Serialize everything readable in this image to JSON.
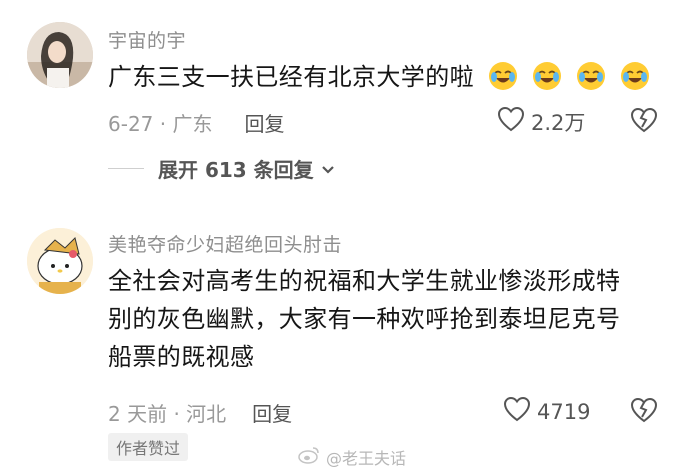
{
  "comments": [
    {
      "username": "宇宙的宇",
      "text": "广东三支一扶已经有北京大学的啦",
      "date_location": "6-27 · 广东",
      "reply_label": "回复",
      "likes": "2.2万",
      "expand_label": "展开 613 条回复"
    },
    {
      "username": "美艳夺命少妇超绝回头肘击",
      "text_line1": "全社会对高考生的祝福和大学生就业惨淡形成特",
      "text_line2": "别的灰色幽默，大家有一种欢呼抢到泰坦尼克号",
      "text_line3": "船票的既视感",
      "date_location": "2 天前 · 河北",
      "reply_label": "回复",
      "likes": "4719",
      "badge": "作者赞过"
    }
  ],
  "watermark": "@老王夫话",
  "icons": {
    "like": "heart-outline-icon",
    "dislike": "broken-heart-icon",
    "expand": "chevron-down-icon",
    "emoji": "crying-laughing-emoji-icon"
  }
}
